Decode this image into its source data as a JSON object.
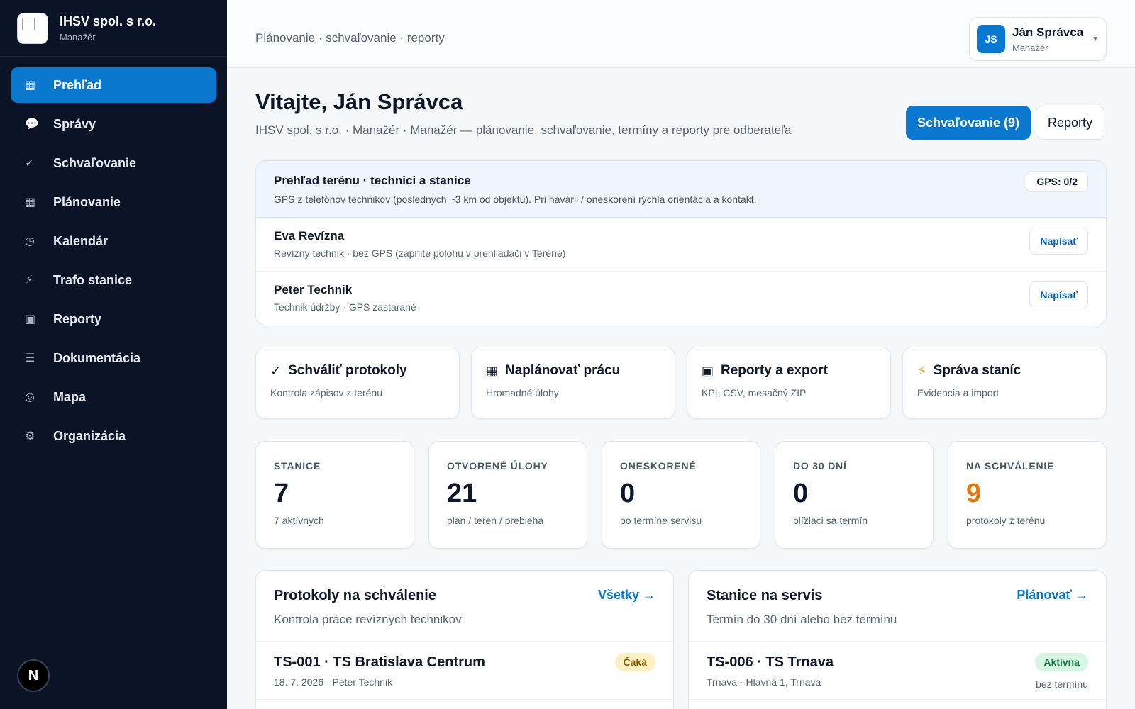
{
  "brand": {
    "name": "IHSV spol. s r.o.",
    "role": "Manažér"
  },
  "sidebar": {
    "items": [
      {
        "icon": "▦",
        "label": "Prehľad",
        "active": true
      },
      {
        "icon": "💬",
        "label": "Správy"
      },
      {
        "icon": "✓",
        "label": "Schvaľovanie"
      },
      {
        "icon": "▦",
        "label": "Plánovanie"
      },
      {
        "icon": "◷",
        "label": "Kalendár"
      },
      {
        "icon": "⚡",
        "label": "Trafo stanice"
      },
      {
        "icon": "▣",
        "label": "Reporty"
      },
      {
        "icon": "☰",
        "label": "Dokumentácia"
      },
      {
        "icon": "◎",
        "label": "Mapa"
      },
      {
        "icon": "⚙",
        "label": "Organizácia"
      }
    ],
    "footer_avatar": "N"
  },
  "header": {
    "breadcrumb": "Plánovanie · schvaľovanie · reporty",
    "user": {
      "initials": "JS",
      "name": "Ján Správca",
      "role": "Manažér"
    }
  },
  "page": {
    "title": "Vitajte, Ján Správca",
    "subtitle": "IHSV spol. s r.o. · Manažér · Manažér — plánovanie, schvaľovanie, termíny a reporty pre odberateľa",
    "primary_button": "Schvaľovanie (9)",
    "secondary_button": "Reporty"
  },
  "terrain": {
    "title": "Prehľad terénu · technici a stanice",
    "description": "GPS z telefónov technikov (posledných ~3 km od objektu). Pri havárii / oneskorení rýchla orientácia a kontakt.",
    "gps_badge": "GPS: 0/2",
    "technicians": [
      {
        "name": "Eva Revízna",
        "meta": "Revízny technik · bez GPS (zapnite polohu v prehliadači v Teréne)",
        "button": "Napísať"
      },
      {
        "name": "Peter Technik",
        "meta": "Technik údržby · GPS zastarané",
        "button": "Napísať"
      }
    ]
  },
  "actions": [
    {
      "icon": "✓",
      "title": "Schváliť protokoly",
      "desc": "Kontrola zápisov z terénu"
    },
    {
      "icon": "▦",
      "title": "Naplánovať prácu",
      "desc": "Hromadné úlohy"
    },
    {
      "icon": "▣",
      "title": "Reporty a export",
      "desc": "KPI, CSV, mesačný ZIP"
    },
    {
      "icon": "⚡",
      "title": "Správa staníc",
      "desc": "Evidencia a import"
    }
  ],
  "stats": [
    {
      "label": "STANICE",
      "value": "7",
      "sub": "7 aktívnych"
    },
    {
      "label": "OTVORENÉ ÚLOHY",
      "value": "21",
      "sub": "plán / terén / prebieha"
    },
    {
      "label": "ONESKORENÉ",
      "value": "0",
      "sub": "po termíne servisu"
    },
    {
      "label": "DO 30 DNÍ",
      "value": "0",
      "sub": "blížiaci sa termín"
    },
    {
      "label": "NA SCHVÁLENIE",
      "value": "9",
      "sub": "protokoly z terénu"
    }
  ],
  "protocols_panel": {
    "title": "Protokoly na schválenie",
    "subtitle": "Kontrola práce revíznych technikov",
    "link": "Všetky →",
    "rows": [
      {
        "title": "TS-001 · TS Bratislava Centrum",
        "meta": "18. 7. 2026 · Peter Technik",
        "badge": "Čaká"
      }
    ]
  },
  "stations_panel": {
    "title": "Stanice na servis",
    "subtitle": "Termín do 30 dní alebo bez termínu",
    "link": "Plánovať →",
    "rows": [
      {
        "title": "TS-006 · TS Trnava",
        "meta": "Trnava · Hlavná 1, Trnava",
        "badge": "Aktívna",
        "note": "bez termínu"
      }
    ]
  },
  "colors": {
    "accent": "#0b78d0",
    "sidebar_bg": "#0b1327",
    "warn": "#e07a10"
  }
}
